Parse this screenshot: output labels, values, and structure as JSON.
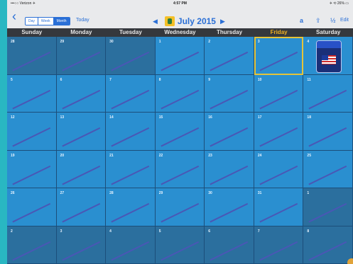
{
  "status_bar": {
    "carrier": "•••○○ Verizon ✈",
    "time": "4:57 PM",
    "battery": "✈ ⟲ 26% ▭"
  },
  "toolbar": {
    "view_modes": [
      {
        "label": "Day",
        "active": false
      },
      {
        "label": "Week",
        "active": false
      },
      {
        "label": "Month",
        "active": true
      }
    ],
    "today_label": "Today",
    "month_label": "July 2015",
    "prev_glyph": "◀",
    "next_glyph": "▶",
    "lock_glyph": "a",
    "share_glyph": "⇪",
    "fraction_glyph": "½",
    "edit_label": "Edit"
  },
  "weekdays": [
    "Sunday",
    "Monday",
    "Tuesday",
    "Wednesday",
    "Thursday",
    "Friday",
    "Saturday"
  ],
  "highlighted_weekday": "Friday",
  "calendar": {
    "weeks": [
      [
        {
          "day": "28",
          "in_month": false
        },
        {
          "day": "29",
          "in_month": false
        },
        {
          "day": "30",
          "in_month": false
        },
        {
          "day": "1",
          "in_month": true
        },
        {
          "day": "2",
          "in_month": true
        },
        {
          "day": "3",
          "in_month": true,
          "selected": true
        },
        {
          "day": "4",
          "in_month": true,
          "event": true
        }
      ],
      [
        {
          "day": "5",
          "in_month": true
        },
        {
          "day": "6",
          "in_month": true
        },
        {
          "day": "7",
          "in_month": true
        },
        {
          "day": "8",
          "in_month": true
        },
        {
          "day": "9",
          "in_month": true
        },
        {
          "day": "10",
          "in_month": true
        },
        {
          "day": "11",
          "in_month": true
        }
      ],
      [
        {
          "day": "12",
          "in_month": true
        },
        {
          "day": "13",
          "in_month": true
        },
        {
          "day": "14",
          "in_month": true
        },
        {
          "day": "15",
          "in_month": true
        },
        {
          "day": "16",
          "in_month": true
        },
        {
          "day": "17",
          "in_month": true
        },
        {
          "day": "18",
          "in_month": true
        }
      ],
      [
        {
          "day": "19",
          "in_month": true
        },
        {
          "day": "20",
          "in_month": true
        },
        {
          "day": "21",
          "in_month": true
        },
        {
          "day": "22",
          "in_month": true
        },
        {
          "day": "23",
          "in_month": true
        },
        {
          "day": "24",
          "in_month": true
        },
        {
          "day": "25",
          "in_month": true
        }
      ],
      [
        {
          "day": "26",
          "in_month": true
        },
        {
          "day": "27",
          "in_month": true
        },
        {
          "day": "28",
          "in_month": true
        },
        {
          "day": "29",
          "in_month": true
        },
        {
          "day": "30",
          "in_month": true
        },
        {
          "day": "31",
          "in_month": true
        },
        {
          "day": "1",
          "in_month": false
        }
      ],
      [
        {
          "day": "2",
          "in_month": false
        },
        {
          "day": "3",
          "in_month": false
        },
        {
          "day": "4",
          "in_month": false
        },
        {
          "day": "5",
          "in_month": false
        },
        {
          "day": "6",
          "in_month": false
        },
        {
          "day": "7",
          "in_month": false
        },
        {
          "day": "8",
          "in_month": false
        }
      ]
    ]
  },
  "colors": {
    "background": "#29b7c2",
    "in_month_cell": "#2a8fd0",
    "out_month_cell": "#2b6f9e",
    "slash": "#4a57b5",
    "selection": "#e4c43a",
    "accent": "#2a6fd6",
    "weekday_bar": "#35383d",
    "weekday_highlight": "#f2b220"
  },
  "icons": [
    "back-chevron-icon",
    "month-app-icon",
    "prev-month-icon",
    "next-month-icon",
    "lock-icon",
    "share-icon",
    "fraction-icon",
    "flag-event-icon"
  ]
}
